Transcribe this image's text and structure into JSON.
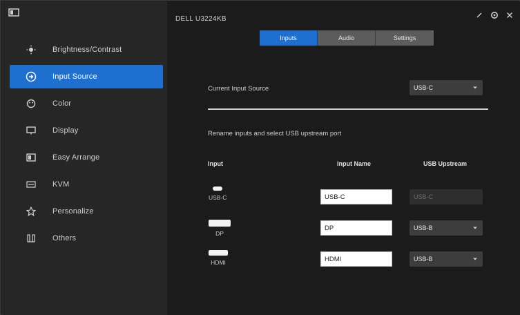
{
  "sidebar": {
    "items": [
      {
        "label": "Brightness/Contrast",
        "icon": "sun-icon",
        "active": false
      },
      {
        "label": "Input Source",
        "icon": "input-source-icon",
        "active": true
      },
      {
        "label": "Color",
        "icon": "color-palette-icon",
        "active": false
      },
      {
        "label": "Display",
        "icon": "display-icon",
        "active": false
      },
      {
        "label": "Easy Arrange",
        "icon": "layout-icon",
        "active": false
      },
      {
        "label": "KVM",
        "icon": "kvm-icon",
        "active": false
      },
      {
        "label": "Personalize",
        "icon": "star-icon",
        "active": false
      },
      {
        "label": "Others",
        "icon": "others-icon",
        "active": false
      }
    ]
  },
  "header": {
    "title": "DELL U3224KB",
    "controls": [
      "minimize-icon",
      "settings-icon",
      "close-icon"
    ]
  },
  "tabs": [
    {
      "label": "Inputs",
      "active": true
    },
    {
      "label": "Audio",
      "active": false
    },
    {
      "label": "Settings",
      "active": false
    }
  ],
  "main": {
    "current_input_label": "Current Input Source",
    "current_input_value": "USB-C",
    "instruction": "Rename inputs and select USB upstream port",
    "columns": {
      "input": "Input",
      "input_name": "Input Name",
      "usb_upstream": "USB Upstream"
    },
    "rows": [
      {
        "port": "USB-C",
        "name": "USB-C",
        "usb": "USB-C",
        "usb_disabled": true
      },
      {
        "port": "DP",
        "name": "DP",
        "usb": "USB-B",
        "usb_disabled": false
      },
      {
        "port": "HDMI",
        "name": "HDMI",
        "usb": "USB-B",
        "usb_disabled": false
      }
    ]
  },
  "colors": {
    "accent": "#1f6fcf",
    "sidebar_bg": "#262626",
    "main_bg": "#1b1b1b"
  }
}
